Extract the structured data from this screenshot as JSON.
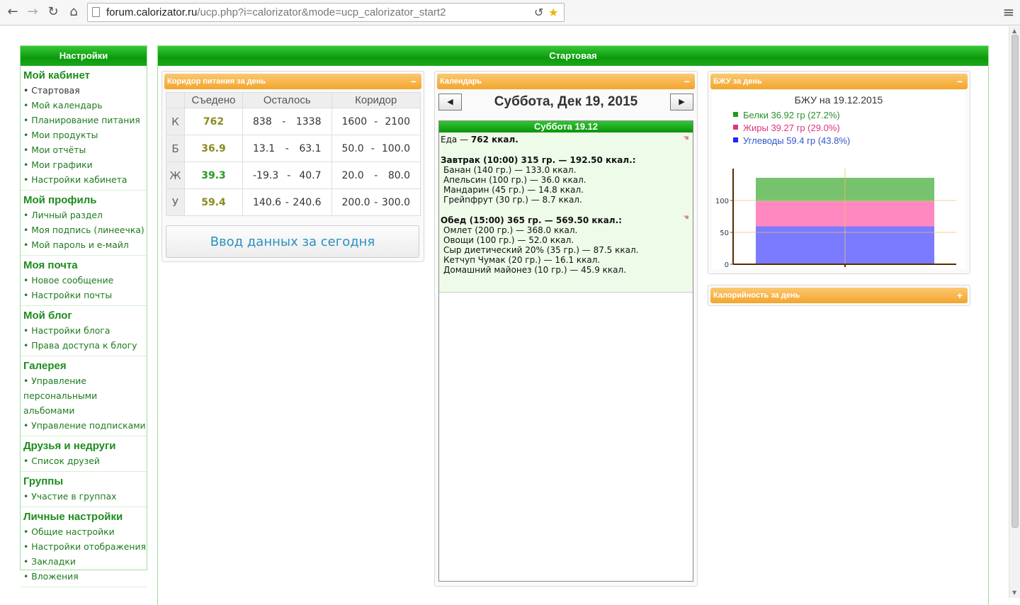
{
  "browser": {
    "url_host": "forum.calorizator.ru",
    "url_path": "/ucp.php?i=calorizator&mode=ucp_calorizator_start2"
  },
  "sidebar": {
    "header": "Настройки",
    "groups": [
      {
        "title": "Мой кабинет",
        "items": [
          "Стартовая",
          "Мой календарь",
          "Планирование питания",
          "Мои продукты",
          "Мои отчёты",
          "Мои графики",
          "Настройки кабинета"
        ]
      },
      {
        "title": "Мой профиль",
        "items": [
          "Личный раздел",
          "Моя подпись (линеечка)",
          "Мой пароль и е-майл"
        ]
      },
      {
        "title": "Моя почта",
        "items": [
          "Новое сообщение",
          "Настройки почты"
        ]
      },
      {
        "title": "Мой блог",
        "items": [
          "Настройки блога",
          "Права доступа к блогу"
        ]
      },
      {
        "title": "Галерея",
        "items": [
          "Управление персональными альбомами",
          "Управление подписками"
        ]
      },
      {
        "title": "Друзья и недруги",
        "items": [
          "Список друзей"
        ]
      },
      {
        "title": "Группы",
        "items": [
          "Участие в группах"
        ]
      },
      {
        "title": "Личные настройки",
        "items": [
          "Общие настройки",
          "Настройки отображения",
          "Закладки",
          "Вложения"
        ]
      }
    ]
  },
  "main": {
    "header": "Стартовая"
  },
  "corridor": {
    "title": "Коридор питания за день",
    "collapse": "−",
    "columns": [
      "Съедено",
      "Осталось",
      "Коридор"
    ],
    "rows": [
      {
        "letter": "К",
        "eaten": "762",
        "left_from": "838",
        "left_to": "1338",
        "cor_from": "1600",
        "cor_to": "2100"
      },
      {
        "letter": "Б",
        "eaten": "36.9",
        "left_from": "13.1",
        "left_to": "63.1",
        "cor_from": "50.0",
        "cor_to": "100.0"
      },
      {
        "letter": "Ж",
        "eaten": "39.3",
        "left_from": "-19.3",
        "left_to": "40.7",
        "cor_from": "20.0",
        "cor_to": "80.0"
      },
      {
        "letter": "У",
        "eaten": "59.4",
        "left_from": "140.6",
        "left_to": "240.6",
        "cor_from": "200.0",
        "cor_to": "300.0"
      }
    ],
    "sep": "-",
    "enter_button": "Ввод данных за сегодня"
  },
  "calendar": {
    "title": "Календарь",
    "collapse": "−",
    "prev": "◀",
    "next": "▶",
    "date_title": "Суббота, Дек 19, 2015",
    "day_header": "Суббота 19.12",
    "food_label": "Еда — ",
    "food_total": "762 ккал.",
    "meals": [
      {
        "title": "Завтрак (10:00) 315 гр. — 192.50 ккал.:",
        "items": [
          "Банан (140 гр.) — 133.0 ккал.",
          "Апельсин (100 гр.) — 36.0 ккал.",
          "Мандарин (45 гр.) — 14.8 ккал.",
          "Грейпфрут (30 гр.) — 8.7 ккал."
        ]
      },
      {
        "title": "Обед (15:00) 365 гр. — 569.50 ккал.:",
        "items": [
          "Омлет (200 гр.) — 368.0 ккал.",
          "Овощи (100 гр.) — 52.0 ккал.",
          "Сыр диетический 20% (35 гр.) — 87.5 ккал.",
          "Кетчуп Чумак (20 гр.) — 16.1 ккал.",
          "Домашний майонез (10 гр.) — 45.9 ккал."
        ]
      }
    ]
  },
  "bju": {
    "title": "БЖУ за день",
    "collapse": "−"
  },
  "calories": {
    "title": "Калорийность за день",
    "expand": "+"
  },
  "chart_data": {
    "type": "bar",
    "stacked": true,
    "title": "БЖУ на 19.12.2015",
    "categories": [
      ""
    ],
    "series": [
      {
        "name": "Белки 36.92 гр (27.2%)",
        "values": [
          36.92
        ],
        "color": "#77c26d"
      },
      {
        "name": "Жиры 39.27 гр (29.0%)",
        "values": [
          39.27
        ],
        "color": "#ff88c0"
      },
      {
        "name": "Углеводы 59.4 гр (43.8%)",
        "values": [
          59.4
        ],
        "color": "#7b7bff"
      }
    ],
    "legend_colors": [
      "#1e9a1e",
      "#e0337f",
      "#2222ff"
    ],
    "legend_text_colors": [
      "#2a8f2a",
      "#e0337f",
      "#3355cc"
    ],
    "yticks": [
      "0",
      "50",
      "100"
    ],
    "ylim": [
      0,
      150
    ],
    "grid": true,
    "legend_position": "top-left"
  }
}
